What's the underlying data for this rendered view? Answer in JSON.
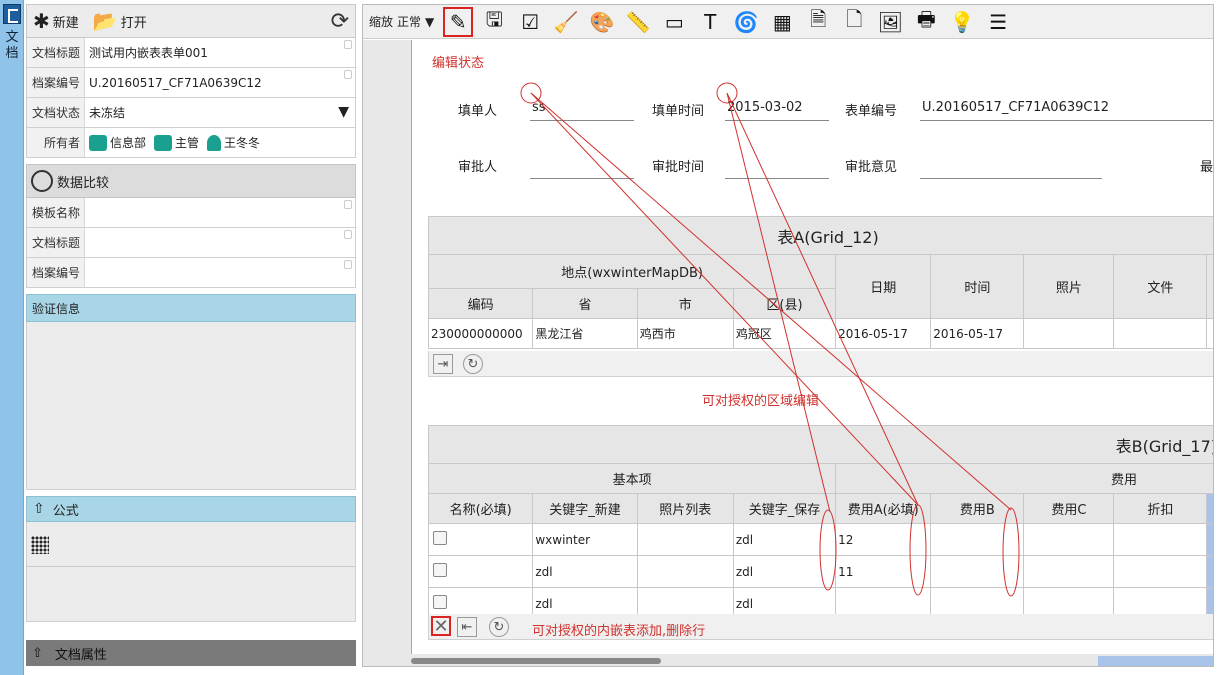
{
  "vstrip": {
    "label": "文档"
  },
  "left": {
    "new_label": "新建",
    "open_label": "打开",
    "fields": [
      {
        "label": "文档标题",
        "value": "测试用内嵌表表单001"
      },
      {
        "label": "档案编号",
        "value": "U.20160517_CF71A0639C12"
      },
      {
        "label": "文档状态",
        "value": "未冻结"
      },
      {
        "label": "所有者",
        "value": ""
      }
    ],
    "owners": [
      "信息部",
      "主管",
      "王冬冬"
    ],
    "compare_title": "数据比较",
    "compare_fields": [
      {
        "label": "模板名称",
        "value": ""
      },
      {
        "label": "文档标题",
        "value": ""
      },
      {
        "label": "档案编号",
        "value": ""
      }
    ],
    "validation_title": "验证信息",
    "formula_title": "公式",
    "props_title": "文档属性"
  },
  "toolbar": {
    "zoom_label": "缩放",
    "zoom_value": "正常"
  },
  "page": {
    "edit_state": "编辑状态",
    "header": {
      "filler_label": "填单人",
      "filler_value": "ss",
      "filltime_label": "填单时间",
      "filltime_value": "2015-03-02",
      "formno_label": "表单编号",
      "formno_value": "U.20160517_CF71A0639C12",
      "approver_label": "审批人",
      "approver_value": "",
      "approvetime_label": "审批时间",
      "approvetime_value": "",
      "opinion_label": "审批意见",
      "opinion_value": "",
      "last_label": "最"
    },
    "gridA": {
      "title": "表A(Grid_12)",
      "group": "地点(wxwinterMapDB)",
      "cols": [
        "编码",
        "省",
        "市",
        "区(县)",
        "日期",
        "时间",
        "照片",
        "文件"
      ],
      "rows": [
        [
          "230000000000",
          "黑龙江省",
          "鸡西市",
          "鸡冠区",
          "2016-05-17",
          "2016-05-17",
          "",
          ""
        ]
      ]
    },
    "note_region": "可对授权的区域编辑",
    "gridB": {
      "title": "表B(Grid_17)",
      "group_basic": "基本项",
      "group_cost": "费用",
      "cols": [
        "名称(必填)",
        "关键字_新建",
        "照片列表",
        "关键字_保存",
        "费用A(必填)",
        "费用B",
        "费用C",
        "折扣"
      ],
      "rows": [
        [
          "",
          "wxwinter",
          "",
          "zdl",
          "12",
          "",
          "",
          ""
        ],
        [
          "",
          "zdl",
          "",
          "zdl",
          "11",
          "",
          "",
          ""
        ],
        [
          "",
          "zdl",
          "",
          "zdl",
          "",
          "",
          "",
          ""
        ]
      ]
    },
    "note_rows": "可对授权的内嵌表添加,删除行"
  },
  "colors": {
    "annotation": "#d0312d",
    "accent": "#a9d6e6"
  }
}
